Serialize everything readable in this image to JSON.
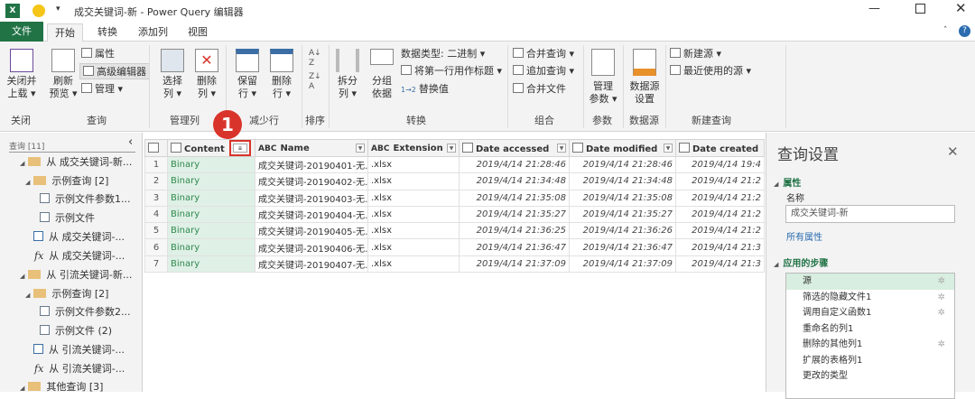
{
  "title_bar": {
    "title": "成交关键词-新 - Power Query 编辑器"
  },
  "tabs": [
    {
      "label": "文件"
    },
    {
      "label": "开始"
    },
    {
      "label": "转换"
    },
    {
      "label": "添加列"
    },
    {
      "label": "视图"
    }
  ],
  "ribbon": {
    "close_load": "关闭并\n上载 ▾",
    "refresh": "刷新\n预览 ▾",
    "properties": "属性",
    "advanced_editor": "高级编辑器",
    "manage": "管理 ▾",
    "choose_cols": "选择\n列 ▾",
    "remove_cols": "删除\n列 ▾",
    "keep_rows": "保留\n行 ▾",
    "remove_rows": "删除\n行 ▾",
    "split": "拆分\n列 ▾",
    "group_by": "分组\n依据",
    "data_type": "数据类型: 二进制 ▾",
    "first_row_header": "将第一行用作标题 ▾",
    "replace_values": "替换值",
    "merge_queries": "合并查询 ▾",
    "append_queries": "追加查询 ▾",
    "combine_files": "合并文件",
    "manage_params": "管理\n参数 ▾",
    "data_source_settings": "数据源\n设置",
    "new_source": "新建源 ▾",
    "recent_sources": "最近使用的源 ▾",
    "groups": [
      "关闭",
      "查询",
      "管理列",
      "减少行",
      "排序",
      "转换",
      "组合",
      "参数",
      "数据源",
      "新建查询"
    ]
  },
  "callout": "1",
  "left_pane": {
    "header": "查询 [11]",
    "items": [
      "从 成交关键词-新...",
      "示例查询 [2]",
      "示例文件参数1...",
      "示例文件",
      "从 成交关键词-...",
      "从 成交关键词-...",
      "从 引流关键词-新...",
      "示例查询 [2]",
      "示例文件参数2...",
      "示例文件 (2)",
      "从 引流关键词-...",
      "从 引流关键词-...",
      "其他查询 [3]"
    ]
  },
  "grid": {
    "columns": [
      "Content",
      "Name",
      "Extension",
      "Date accessed",
      "Date modified",
      "Date created"
    ],
    "rows": [
      [
        "1",
        "Binary",
        "成交关键词-20190401-无...",
        ".xlsx",
        "2019/4/14 21:28:46",
        "2019/4/14 21:28:46",
        "2019/4/14 19:4"
      ],
      [
        "2",
        "Binary",
        "成交关键词-20190402-无...",
        ".xlsx",
        "2019/4/14 21:34:48",
        "2019/4/14 21:34:48",
        "2019/4/14 21:2"
      ],
      [
        "3",
        "Binary",
        "成交关键词-20190403-无...",
        ".xlsx",
        "2019/4/14 21:35:08",
        "2019/4/14 21:35:08",
        "2019/4/14 21:2"
      ],
      [
        "4",
        "Binary",
        "成交关键词-20190404-无...",
        ".xlsx",
        "2019/4/14 21:35:27",
        "2019/4/14 21:35:27",
        "2019/4/14 21:2"
      ],
      [
        "5",
        "Binary",
        "成交关键词-20190405-无...",
        ".xlsx",
        "2019/4/14 21:36:25",
        "2019/4/14 21:36:26",
        "2019/4/14 21:2"
      ],
      [
        "6",
        "Binary",
        "成交关键词-20190406-无...",
        ".xlsx",
        "2019/4/14 21:36:47",
        "2019/4/14 21:36:47",
        "2019/4/14 21:3"
      ],
      [
        "7",
        "Binary",
        "成交关键词-20190407-无...",
        ".xlsx",
        "2019/4/14 21:37:09",
        "2019/4/14 21:37:09",
        "2019/4/14 21:3"
      ]
    ]
  },
  "right_pane": {
    "title": "查询设置",
    "properties_header": "属性",
    "name_label": "名称",
    "name_value": "成交关键词-新",
    "all_properties": "所有属性",
    "steps_header": "应用的步骤",
    "steps": [
      "源",
      "筛选的隐藏文件1",
      "调用自定义函数1",
      "重命名的列1",
      "删除的其他列1",
      "扩展的表格列1",
      "更改的类型"
    ]
  },
  "colors": {
    "accent": "#217346",
    "callout": "#d9342b"
  }
}
